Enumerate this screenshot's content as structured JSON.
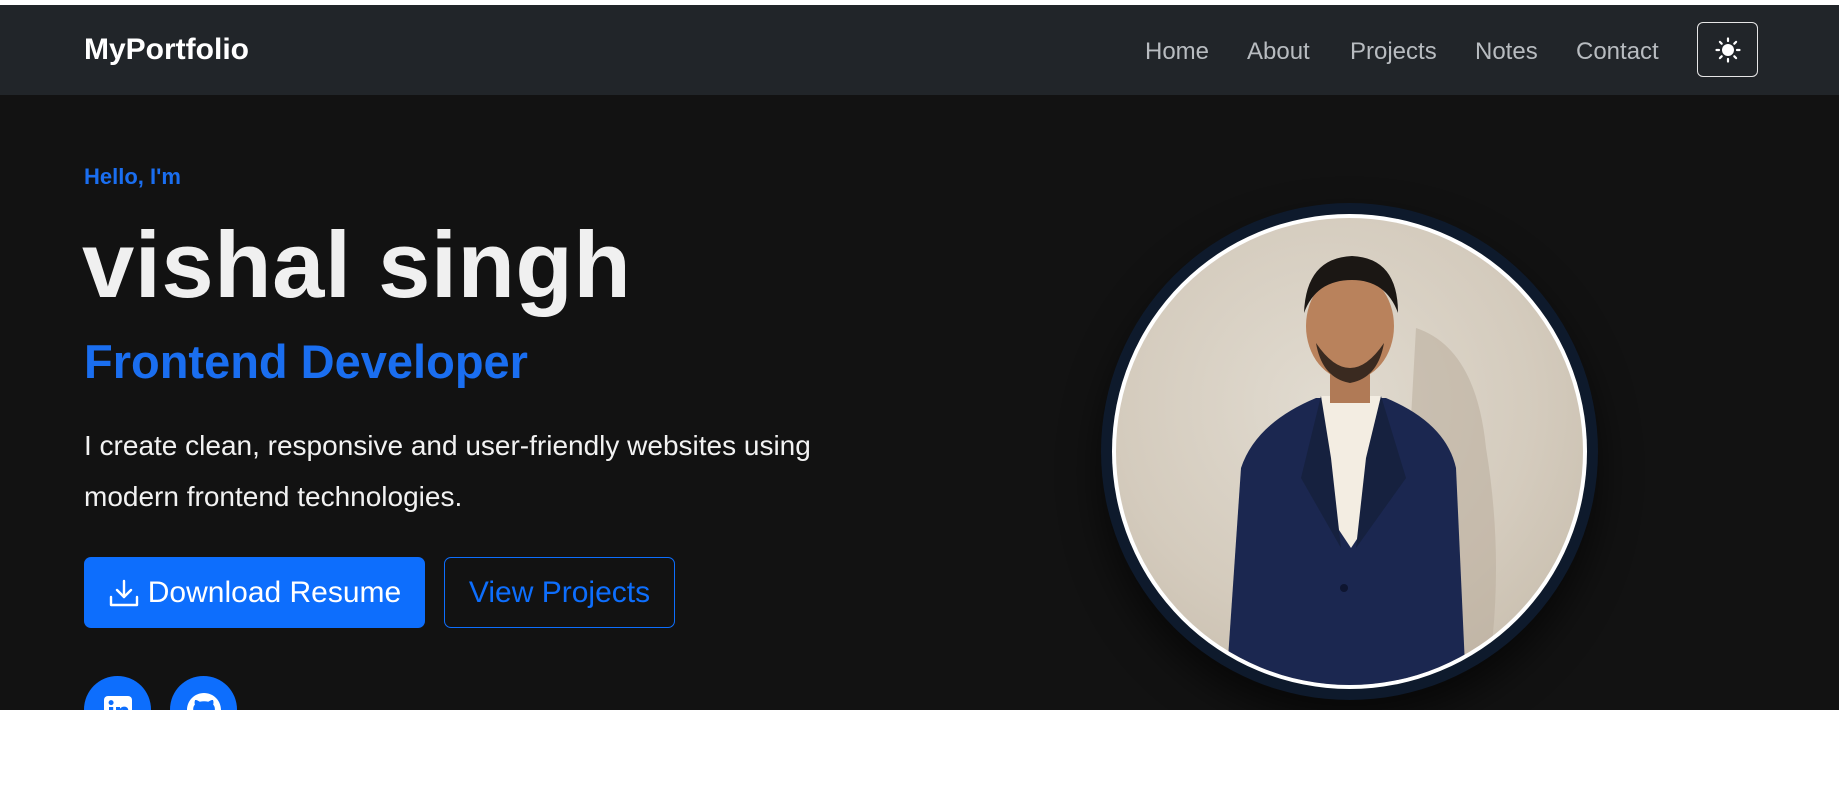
{
  "navbar": {
    "brand": "MyPortfolio",
    "links": [
      "Home",
      "About",
      "Projects",
      "Notes",
      "Contact"
    ],
    "theme_toggle_icon": "sun-icon"
  },
  "hero": {
    "greeting": "Hello, I'm",
    "name": "vishal singh",
    "role": "Frontend Developer",
    "description": "I create clean, responsive and user-friendly websites using modern frontend technologies.",
    "primary_button": "Download Resume",
    "primary_button_icon": "download-icon",
    "secondary_button": "View Projects",
    "socials": [
      {
        "name": "linkedin",
        "icon": "linkedin-icon"
      },
      {
        "name": "github",
        "icon": "github-icon"
      }
    ],
    "photo": "profile-photo"
  },
  "colors": {
    "navbar_bg": "#212529",
    "hero_bg": "#121212",
    "accent": "#0d6efd",
    "accent_text": "#1a6ef0",
    "heading": "#f0f0f0",
    "nav_link": "#b8bcc0"
  }
}
